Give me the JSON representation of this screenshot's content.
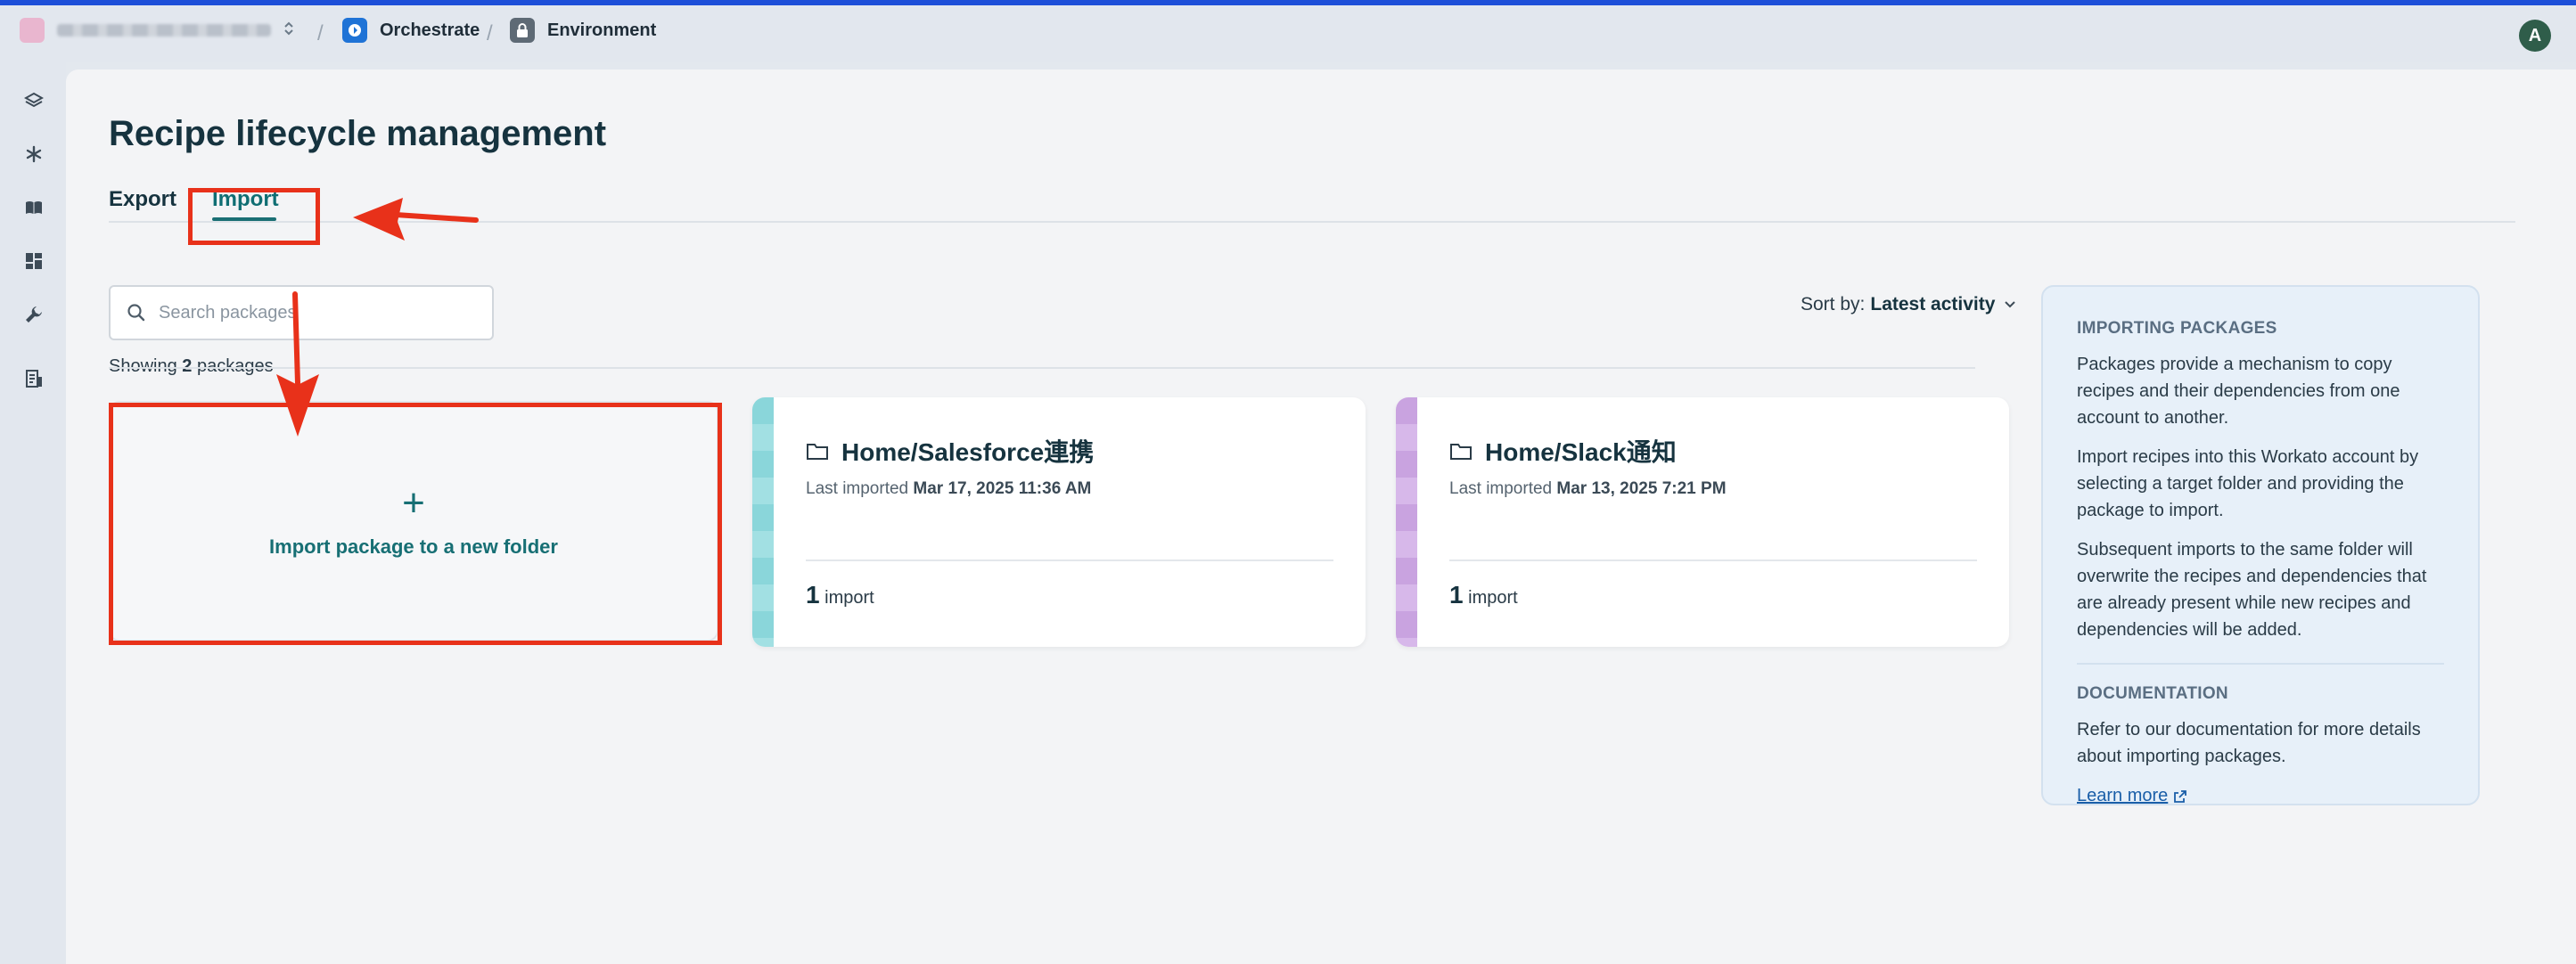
{
  "topbar": {
    "breadcrumbs": [
      {
        "label": "Orchestrate",
        "icon": "orchestrate-icon"
      },
      {
        "label": "Environment",
        "icon": "lock-icon"
      }
    ],
    "avatar_initial": "A"
  },
  "sidebar": {
    "icons": [
      "layers-icon",
      "asterisk-icon",
      "book-icon",
      "dashboard-icon",
      "wrench-icon",
      "document-icon"
    ]
  },
  "page": {
    "title": "Recipe lifecycle management",
    "tabs": [
      {
        "label": "Export",
        "active": false
      },
      {
        "label": "Import",
        "active": true
      }
    ]
  },
  "search": {
    "placeholder": "Search packages",
    "value": ""
  },
  "sort": {
    "prefix": "Sort by:",
    "value": "Latest activity"
  },
  "showing": {
    "prefix": "Showing",
    "count": "2",
    "suffix": "packages"
  },
  "new_package": {
    "label": "Import package to a new folder",
    "plus": "+"
  },
  "packages": [
    {
      "title": "Home/Salesforce連携",
      "meta_prefix": "Last imported",
      "meta_value": "Mar 17, 2025 11:36 AM",
      "count": "1",
      "count_label": "import",
      "stripe_color": "#8ad6da"
    },
    {
      "title": "Home/Slack通知",
      "meta_prefix": "Last imported",
      "meta_value": "Mar 13, 2025 7:21 PM",
      "count": "1",
      "count_label": "import",
      "stripe_color": "#c9a3e0"
    }
  ],
  "info_panel": {
    "importing_heading": "IMPORTING PACKAGES",
    "paragraphs": [
      "Packages provide a mechanism to copy recipes and their dependencies from one account to another.",
      "Import recipes into this Workato account by selecting a target folder and providing the package to import.",
      "Subsequent imports to the same folder will overwrite the recipes and dependencies that are already present while new recipes and dependencies will be added."
    ],
    "doc_heading": "DOCUMENTATION",
    "doc_text": "Refer to our documentation for more details about importing packages.",
    "learn_more": "Learn more"
  },
  "colors": {
    "accent": "#176f74",
    "annotation": "#e8311a",
    "topbar_strip": "#1d4fd8"
  }
}
